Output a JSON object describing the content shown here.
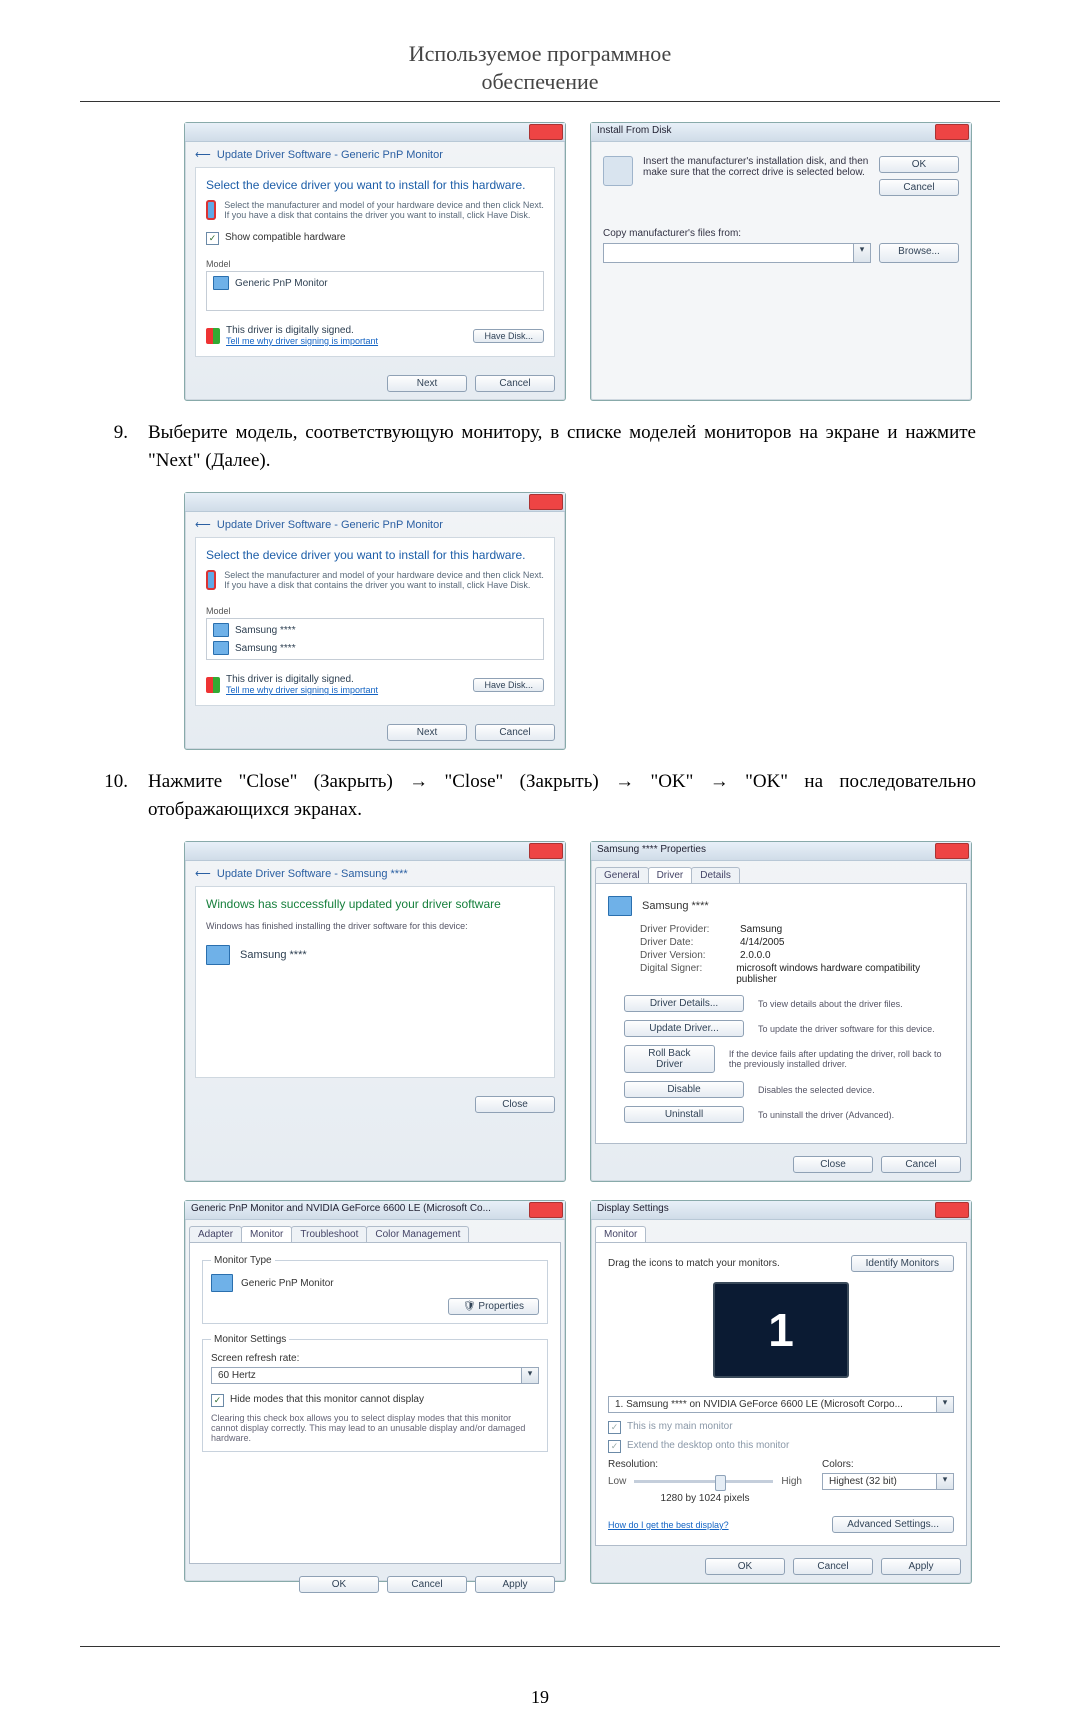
{
  "header": {
    "title_line1": "Используемое программное",
    "title_line2": "обеспечение"
  },
  "step9": {
    "num": "9.",
    "text": "Выберите модель, соответствующую монитору, в списке моделей мониторов на экране и нажмите \"Next\" (Далее)."
  },
  "step10": {
    "num": "10.",
    "text": "Нажмите \"Close\" (Закрыть) → \"Close\" (Закрыть) → \"OK\" → \"OK\" на последовательно отображающихся экранах."
  },
  "win_driverselect1": {
    "crumb": "Update Driver Software - Generic PnP Monitor",
    "heading": "Select the device driver you want to install for this hardware.",
    "instr": "Select the manufacturer and model of your hardware device and then click Next. If you have a disk that contains the driver you want to install, click Have Disk.",
    "show_compat": "Show compatible hardware",
    "model_label": "Model",
    "model_item": "Generic PnP Monitor",
    "signed": "This driver is digitally signed.",
    "signed_link": "Tell me why driver signing is important",
    "have_disk": "Have Disk...",
    "next": "Next",
    "cancel": "Cancel"
  },
  "win_installdisk": {
    "title": "Install From Disk",
    "instr": "Insert the manufacturer's installation disk, and then make sure that the correct drive is selected below.",
    "ok": "OK",
    "cancel": "Cancel",
    "copy_label": "Copy manufacturer's files from:",
    "browse": "Browse..."
  },
  "win_driverselect2": {
    "crumb": "Update Driver Software - Generic PnP Monitor",
    "heading": "Select the device driver you want to install for this hardware.",
    "instr": "Select the manufacturer and model of your hardware device and then click Next. If you have a disk that contains the driver you want to install, click Have Disk.",
    "model_label": "Model",
    "model_item1": "Samsung ****",
    "model_item2": "Samsung ****",
    "signed": "This driver is digitally signed.",
    "signed_link": "Tell me why driver signing is important",
    "have_disk": "Have Disk...",
    "next": "Next",
    "cancel": "Cancel"
  },
  "win_updatedone": {
    "crumb": "Update Driver Software - Samsung ****",
    "heading": "Windows has successfully updated your driver software",
    "sub": "Windows has finished installing the driver software for this device:",
    "device": "Samsung ****",
    "close": "Close"
  },
  "win_props": {
    "title": "Samsung **** Properties",
    "tab_general": "General",
    "tab_driver": "Driver",
    "tab_details": "Details",
    "device": "Samsung ****",
    "kv": {
      "provider_k": "Driver Provider:",
      "provider_v": "Samsung",
      "date_k": "Driver Date:",
      "date_v": "4/14/2005",
      "version_k": "Driver Version:",
      "version_v": "2.0.0.0",
      "signer_k": "Digital Signer:",
      "signer_v": "microsoft windows hardware compatibility publisher"
    },
    "btn_details": "Driver Details...",
    "desc_details": "To view details about the driver files.",
    "btn_update": "Update Driver...",
    "desc_update": "To update the driver software for this device.",
    "btn_roll": "Roll Back Driver",
    "desc_roll": "If the device fails after updating the driver, roll back to the previously installed driver.",
    "btn_disable": "Disable",
    "desc_disable": "Disables the selected device.",
    "btn_uninst": "Uninstall",
    "desc_uninst": "To uninstall the driver (Advanced).",
    "close": "Close",
    "cancel": "Cancel"
  },
  "win_monprops": {
    "title": "Generic PnP Monitor and NVIDIA GeForce 6600 LE (Microsoft Co...",
    "tab_adapter": "Adapter",
    "tab_monitor": "Monitor",
    "tab_trouble": "Troubleshoot",
    "tab_color": "Color Management",
    "grp_type": "Monitor Type",
    "type_value": "Generic PnP Monitor",
    "btn_props": "Properties",
    "grp_settings": "Monitor Settings",
    "refresh_label": "Screen refresh rate:",
    "refresh_value": "60 Hertz",
    "hide_check": "Hide modes that this monitor cannot display",
    "hide_desc": "Clearing this check box allows you to select display modes that this monitor cannot display correctly. This may lead to an unusable display and/or damaged hardware.",
    "ok": "OK",
    "cancel": "Cancel",
    "apply": "Apply"
  },
  "win_display": {
    "title": "Display Settings",
    "tab_monitor": "Monitor",
    "drag": "Drag the icons to match your monitors.",
    "identify": "Identify Monitors",
    "mon_num": "1",
    "selected": "1. Samsung **** on NVIDIA GeForce 6600 LE (Microsoft Corpo...",
    "main_check": "This is my main monitor",
    "extend_check": "Extend the desktop onto this monitor",
    "res_label": "Resolution:",
    "res_low": "Low",
    "res_high": "High",
    "res_value": "1280 by 1024 pixels",
    "colors_label": "Colors:",
    "colors_value": "Highest (32 bit)",
    "best_link": "How do I get the best display?",
    "advanced": "Advanced Settings...",
    "ok": "OK",
    "cancel": "Cancel",
    "apply": "Apply"
  },
  "footer": {
    "page": "19"
  }
}
